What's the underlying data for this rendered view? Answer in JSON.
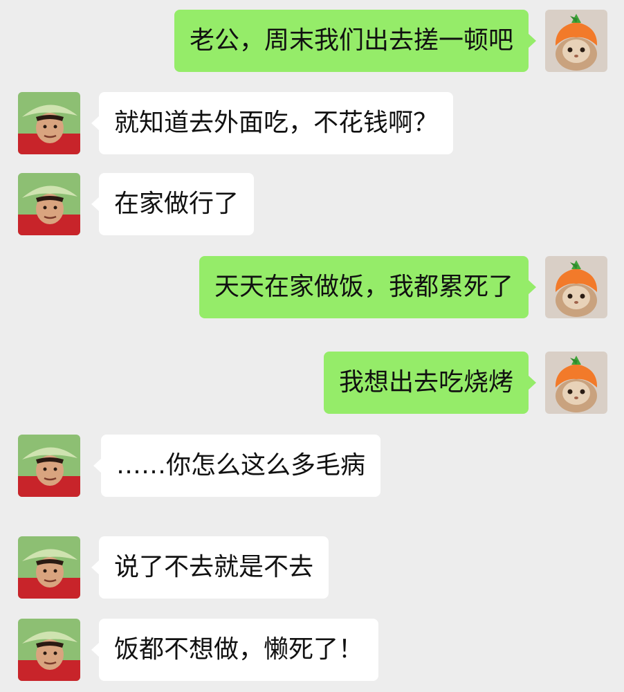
{
  "messages": [
    {
      "sender": "wife",
      "text": "老公，周末我们出去搓一顿吧"
    },
    {
      "sender": "husband",
      "text": "就知道去外面吃，不花钱啊？"
    },
    {
      "sender": "husband",
      "text": "在家做行了"
    },
    {
      "sender": "wife",
      "text": "天天在家做饭，我都累死了"
    },
    {
      "sender": "wife",
      "text": "我想出去吃烧烤"
    },
    {
      "sender": "husband",
      "text": "……你怎么这么多毛病"
    },
    {
      "sender": "husband",
      "text": "说了不去就是不去"
    },
    {
      "sender": "husband",
      "text": "饭都不想做，懒死了！"
    }
  ],
  "colors": {
    "background": "#ededed",
    "outgoing_bubble": "#95ec69",
    "incoming_bubble": "#ffffff"
  },
  "avatars": {
    "wife": "rabbit-carrot-hat-avatar",
    "husband": "man-straw-hat-avatar"
  }
}
